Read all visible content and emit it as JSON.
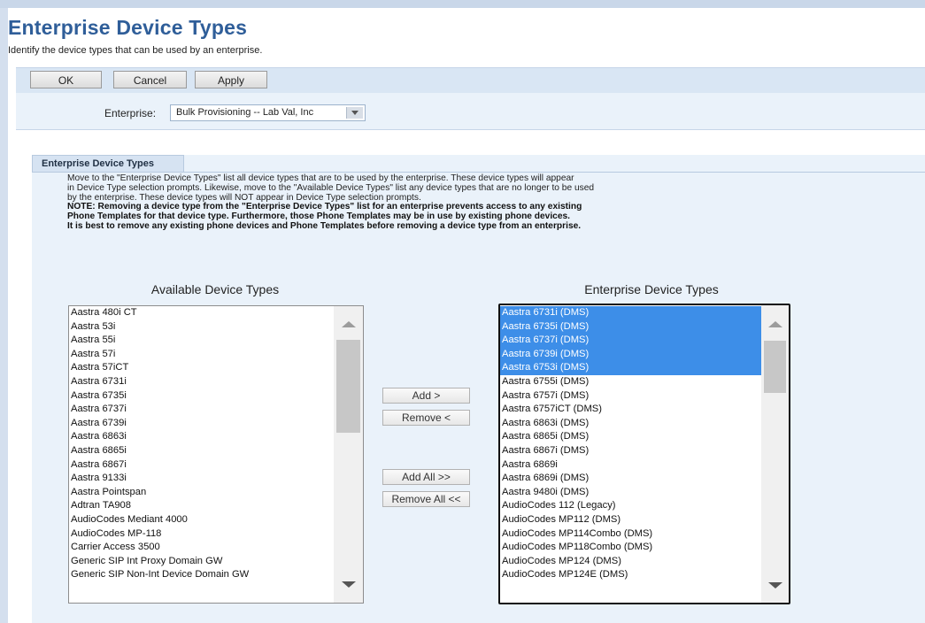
{
  "header": {
    "title": "Enterprise Device Types",
    "subtitle": "Identify the device types that can be used by an enterprise."
  },
  "toolbar": {
    "ok_label": "OK",
    "cancel_label": "Cancel",
    "apply_label": "Apply"
  },
  "filter": {
    "enterprise_label": "Enterprise:",
    "enterprise_value": "Bulk Provisioning -- Lab Val, Inc"
  },
  "section": {
    "title": "Enterprise Device Types",
    "description": [
      "Move to the \"Enterprise Device Types\" list all device types that are to be used by the enterprise. These device types will appear",
      "in Device Type selection prompts. Likewise, move to the \"Available Device Types\" list any device types that are no longer to be used",
      "by the enterprise. These device types will NOT appear in Device Type selection prompts.",
      "NOTE: Removing a device type from the \"Enterprise Device Types\" list for an enterprise prevents access to any existing",
      "Phone Templates for that device type. Furthermore, those Phone Templates may be in use by existing phone devices.",
      "It is best to remove any existing phone devices and Phone Templates before removing a device type from an enterprise."
    ]
  },
  "available": {
    "title": "Available Device Types",
    "items": [
      "Aastra 480i CT",
      "Aastra 53i",
      "Aastra 55i",
      "Aastra 57i",
      "Aastra 57iCT",
      "Aastra 6731i",
      "Aastra 6735i",
      "Aastra 6737i",
      "Aastra 6739i",
      "Aastra 6863i",
      "Aastra 6865i",
      "Aastra 6867i",
      "Aastra 9133i",
      "Aastra Pointspan",
      "Adtran TA908",
      "AudioCodes Mediant 4000",
      "AudioCodes MP-118",
      "Carrier Access 3500",
      "Generic SIP Int Proxy Domain GW",
      "Generic SIP Non-Int Device Domain GW"
    ]
  },
  "actions": {
    "add_label": "Add >",
    "remove_label": "Remove <",
    "add_all_label": "Add All >>",
    "remove_all_label": "Remove All <<"
  },
  "enterprise": {
    "title": "Enterprise Device Types",
    "items": [
      "Aastra 6731i (DMS)",
      "Aastra 6735i (DMS)",
      "Aastra 6737i (DMS)",
      "Aastra 6739i (DMS)",
      "Aastra 6753i (DMS)",
      "Aastra 6755i (DMS)",
      "Aastra 6757i (DMS)",
      "Aastra 6757iCT (DMS)",
      "Aastra 6863i (DMS)",
      "Aastra 6865i (DMS)",
      "Aastra 6867i (DMS)",
      "Aastra 6869i",
      "Aastra 6869i (DMS)",
      "Aastra 9480i (DMS)",
      "AudioCodes 112 (Legacy)",
      "AudioCodes MP112 (DMS)",
      "AudioCodes MP114Combo (DMS)",
      "AudioCodes MP118Combo (DMS)",
      "AudioCodes MP124 (DMS)",
      "AudioCodes MP124E (DMS)"
    ],
    "selected_count": 5
  }
}
